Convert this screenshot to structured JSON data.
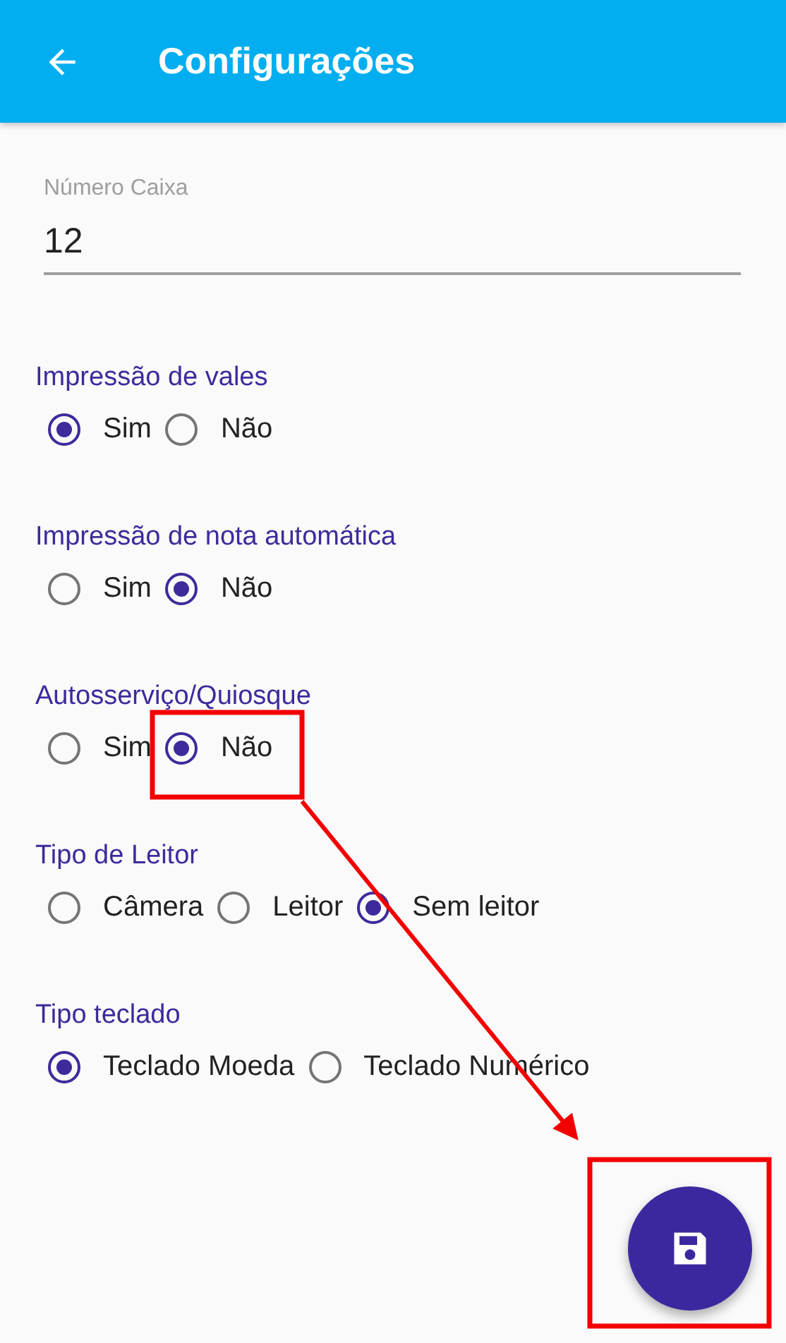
{
  "app_bar": {
    "title": "Configurações"
  },
  "field": {
    "label": "Número Caixa",
    "value": "12"
  },
  "groups": [
    {
      "label": "Impressão de vales",
      "options": [
        {
          "label": "Sim",
          "selected": true
        },
        {
          "label": "Não",
          "selected": false
        }
      ]
    },
    {
      "label": "Impressão de nota automática",
      "options": [
        {
          "label": "Sim",
          "selected": false
        },
        {
          "label": "Não",
          "selected": true
        }
      ]
    },
    {
      "label": "Autosserviço/Quiosque",
      "options": [
        {
          "label": "Sim",
          "selected": false
        },
        {
          "label": "Não",
          "selected": true
        }
      ]
    },
    {
      "label": "Tipo de Leitor",
      "options": [
        {
          "label": "Câmera",
          "selected": false
        },
        {
          "label": "Leitor",
          "selected": false
        },
        {
          "label": "Sem leitor",
          "selected": true
        }
      ]
    },
    {
      "label": "Tipo teclado",
      "options": [
        {
          "label": "Teclado Moeda",
          "selected": true
        },
        {
          "label": "Teclado Numérico",
          "selected": false
        }
      ]
    }
  ],
  "annotations": [
    {
      "kind": "box"
    },
    {
      "kind": "arrow"
    },
    {
      "kind": "box"
    }
  ]
}
